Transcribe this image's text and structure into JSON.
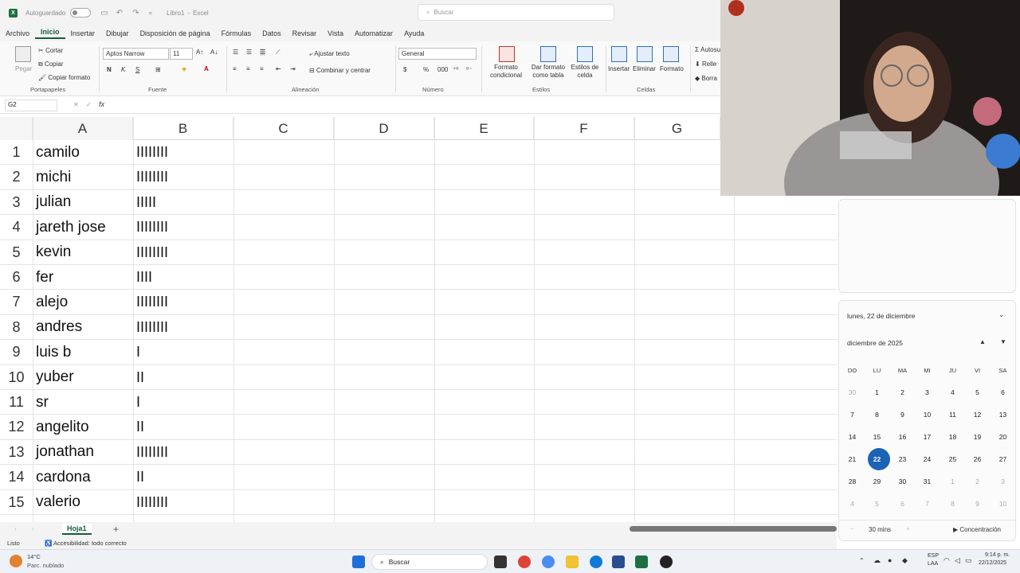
{
  "titlebar": {
    "autosave": "Autoguardado",
    "doc": "Libro1",
    "app": "Excel",
    "search_placeholder": "Buscar"
  },
  "menu": [
    "Archivo",
    "Inicio",
    "Insertar",
    "Dibujar",
    "Disposición de página",
    "Fórmulas",
    "Datos",
    "Revisar",
    "Vista",
    "Automatizar",
    "Ayuda"
  ],
  "ribbon": {
    "paste": "Pegar",
    "cut": "Cortar",
    "copy": "Copiar",
    "format_painter": "Copiar formato",
    "clipboard": "Portapapeles",
    "font_name": "Aptos Narrow",
    "font_size": "11",
    "font_group": "Fuente",
    "wrap_text": "Ajustar texto",
    "merge_center": "Combinar y centrar",
    "alignment": "Alineación",
    "number_format": "General",
    "number": "Número",
    "cond_format": "Formato condicional",
    "format_table": "Dar formato como tabla",
    "cell_styles": "Estilos de celda",
    "styles": "Estilos",
    "insert": "Insertar",
    "delete": "Eliminar",
    "format": "Formato",
    "cells": "Celdas",
    "autosum": "Autosu",
    "fill": "Relle",
    "clear": "Borra"
  },
  "formula_bar": {
    "name_box": "G2",
    "fx": "fx",
    "value": ""
  },
  "columns": [
    "A",
    "B",
    "C",
    "D",
    "E",
    "F",
    "G"
  ],
  "rows": [
    {
      "n": "1",
      "a": "camilo",
      "b": "IIIIIIII"
    },
    {
      "n": "2",
      "a": "michi",
      "b": "IIIIIIII"
    },
    {
      "n": "3",
      "a": "julian",
      "b": "IIIII"
    },
    {
      "n": "4",
      "a": "jareth jose",
      "b": "IIIIIIII"
    },
    {
      "n": "5",
      "a": "kevin",
      "b": "IIIIIIII"
    },
    {
      "n": "6",
      "a": "fer",
      "b": "IIII"
    },
    {
      "n": "7",
      "a": "alejo",
      "b": "IIIIIIII"
    },
    {
      "n": "8",
      "a": "andres",
      "b": "IIIIIIII"
    },
    {
      "n": "9",
      "a": "luis b",
      "b": "I"
    },
    {
      "n": "10",
      "a": "yuber",
      "b": "II"
    },
    {
      "n": "11",
      "a": "sr",
      "b": "I"
    },
    {
      "n": "12",
      "a": "angelito",
      "b": "II"
    },
    {
      "n": "13",
      "a": "jonathan",
      "b": "IIIIIIII"
    },
    {
      "n": "14",
      "a": "cardona",
      "b": "II"
    },
    {
      "n": "15",
      "a": "valerio",
      "b": "IIIIIIII"
    }
  ],
  "sheet_tab": "Hoja1",
  "status": {
    "ready": "Listo",
    "accessibility": "Accesibilidad: todo correcto"
  },
  "calendar": {
    "date_header": "lunes, 22 de diciembre",
    "month": "diciembre de 2025",
    "dows": [
      "DO",
      "LU",
      "MA",
      "MI",
      "JU",
      "VI",
      "SA"
    ],
    "weeks": [
      [
        "30",
        "1",
        "2",
        "3",
        "4",
        "5",
        "6"
      ],
      [
        "7",
        "8",
        "9",
        "10",
        "11",
        "12",
        "13"
      ],
      [
        "14",
        "15",
        "16",
        "17",
        "18",
        "19",
        "20"
      ],
      [
        "21",
        "22",
        "23",
        "24",
        "25",
        "26",
        "27"
      ],
      [
        "28",
        "29",
        "30",
        "31",
        "1",
        "2",
        "3"
      ],
      [
        "4",
        "5",
        "6",
        "7",
        "8",
        "9",
        "10"
      ]
    ],
    "today": "22",
    "focus_minutes": "30 mins",
    "focus_button": "Concentración"
  },
  "taskbar": {
    "weather_temp": "14°C",
    "weather_desc": "Parc. nublado",
    "search": "Buscar",
    "lang": "ESP",
    "region": "LAA",
    "time": "9:14 p. m.",
    "date": "22/12/2025"
  }
}
